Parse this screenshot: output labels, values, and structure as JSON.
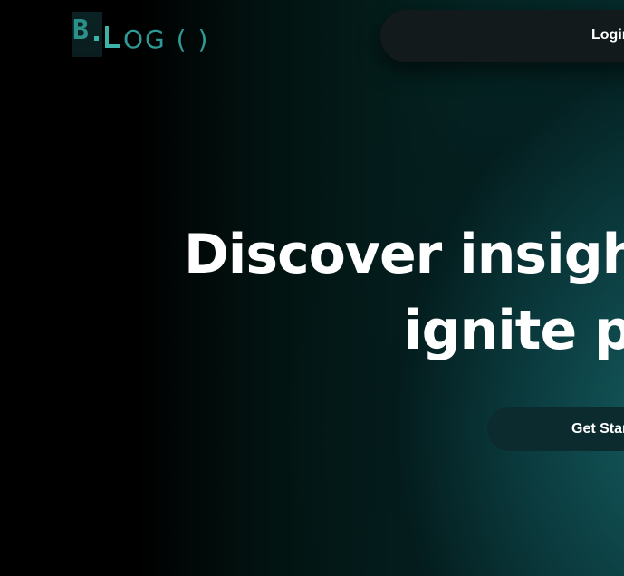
{
  "logo": {
    "mark_letter": "B",
    "text": "OG ( )",
    "icon": "blog-logo-icon",
    "accent_color": "#3bb3a8"
  },
  "nav": {
    "login_label": "Login"
  },
  "hero": {
    "line1": "Discover insights",
    "line2": "ignite po"
  },
  "cta": {
    "label": "Get Star"
  },
  "colors": {
    "background_dark": "#000000",
    "background_teal": "#166064",
    "nav_background": "#131a1b",
    "cta_background": "#0c2b2f",
    "text": "#ffffff"
  }
}
